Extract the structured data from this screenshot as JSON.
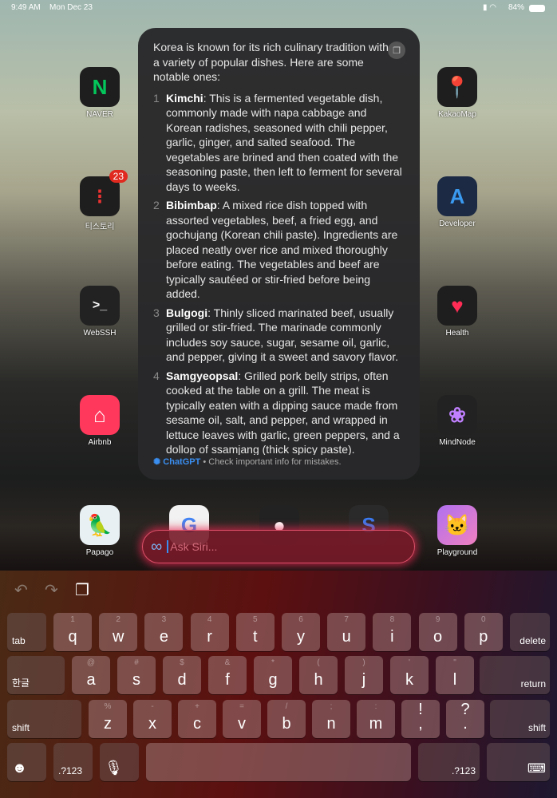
{
  "status": {
    "time": "9:49 AM",
    "date": "Mon Dec 23",
    "battery": "84%"
  },
  "apps": {
    "naver": {
      "label": "NAVER",
      "glyph": "N"
    },
    "tistory": {
      "label": "티스토리",
      "badge": "23"
    },
    "webssh": {
      "label": "WebSSH",
      "glyph": ">_"
    },
    "airbnb": {
      "label": "Airbnb"
    },
    "kakaomap": {
      "label": "KakaoMap"
    },
    "developer": {
      "label": "Developer"
    },
    "health": {
      "label": "Health"
    },
    "mindnode": {
      "label": "MindNode"
    },
    "papago": {
      "label": "Papago"
    },
    "playground": {
      "label": "Playground"
    }
  },
  "card": {
    "intro": "Korea is known for its rich culinary tradition with a variety of popular dishes. Here are some notable ones:",
    "items": [
      {
        "n": "1",
        "name": "Kimchi",
        "text": ": This is a fermented vegetable dish, commonly made with napa cabbage and Korean radishes, seasoned with chili pepper, garlic, ginger, and salted seafood. The vegetables are brined and then coated with the seasoning paste, then left to ferment for several days to weeks."
      },
      {
        "n": "2",
        "name": "Bibimbap",
        "text": ": A mixed rice dish topped with assorted vegetables, beef, a fried egg, and gochujang (Korean chili paste). Ingredients are placed neatly over rice and mixed thoroughly before eating. The vegetables and beef are typically sautéed or stir-fried before being added."
      },
      {
        "n": "3",
        "name": "Bulgogi",
        "text": ": Thinly sliced marinated beef, usually grilled or stir-fried. The marinade commonly includes soy sauce, sugar, sesame oil, garlic, and pepper, giving it a sweet and savory flavor."
      },
      {
        "n": "4",
        "name": "Samgyeopsal",
        "text": ": Grilled pork belly strips, often cooked at the table on a grill. The meat is typically eaten with a dipping sauce made from sesame oil, salt, and pepper, and wrapped in lettuce leaves with garlic, green peppers, and a dollop of ssamjang (thick spicy paste)."
      }
    ],
    "source": "ChatGPT",
    "disclaimer": " • Check important info for mistakes."
  },
  "siri": {
    "placeholder": "Ask Siri..."
  },
  "keyboard": {
    "row1": [
      [
        "q",
        "1"
      ],
      [
        "w",
        "2"
      ],
      [
        "e",
        "3"
      ],
      [
        "r",
        "4"
      ],
      [
        "t",
        "5"
      ],
      [
        "y",
        "6"
      ],
      [
        "u",
        "7"
      ],
      [
        "i",
        "8"
      ],
      [
        "o",
        "9"
      ],
      [
        "p",
        "0"
      ]
    ],
    "row2": [
      [
        "a",
        "@"
      ],
      [
        "s",
        "#"
      ],
      [
        "d",
        "$"
      ],
      [
        "f",
        "&"
      ],
      [
        "g",
        "*"
      ],
      [
        "h",
        "("
      ],
      [
        "j",
        ")"
      ],
      [
        "k",
        "'"
      ],
      [
        "l",
        "\""
      ]
    ],
    "row3": [
      [
        "z",
        "%"
      ],
      [
        "x",
        "-"
      ],
      [
        "c",
        "+"
      ],
      [
        "v",
        "="
      ],
      [
        "b",
        "/"
      ],
      [
        "n",
        ";"
      ],
      [
        "m",
        ":"
      ],
      [
        ",",
        "!"
      ],
      [
        ".",
        "?"
      ]
    ],
    "tab": "tab",
    "delete": "delete",
    "lang": "한글",
    "return": "return",
    "shift": "shift",
    "numbers": ".?123"
  }
}
